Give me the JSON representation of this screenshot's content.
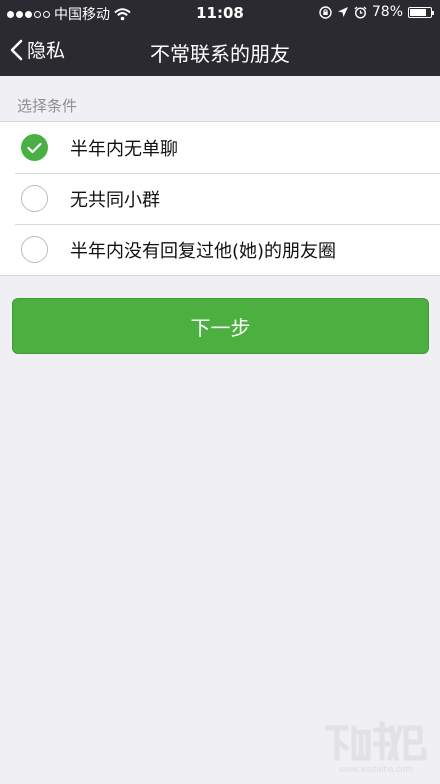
{
  "status_bar": {
    "carrier": "中国移动",
    "time": "11:08",
    "battery": "78%",
    "battery_level": 0.78
  },
  "nav": {
    "back_label": "隐私",
    "title": "不常联系的朋友"
  },
  "section": {
    "label": "选择条件"
  },
  "options": [
    {
      "label": "半年内无单聊",
      "checked": true
    },
    {
      "label": "无共同小群",
      "checked": false
    },
    {
      "label": "半年内没有回复过他(她)的朋友圈",
      "checked": false
    }
  ],
  "actions": {
    "next_label": "下一步"
  },
  "colors": {
    "accent_green": "#4bb044",
    "nav_bg": "#2b2a30",
    "page_bg": "#efeff4"
  },
  "watermark": {
    "text": "下载吧 www.xiazaiba.com"
  }
}
